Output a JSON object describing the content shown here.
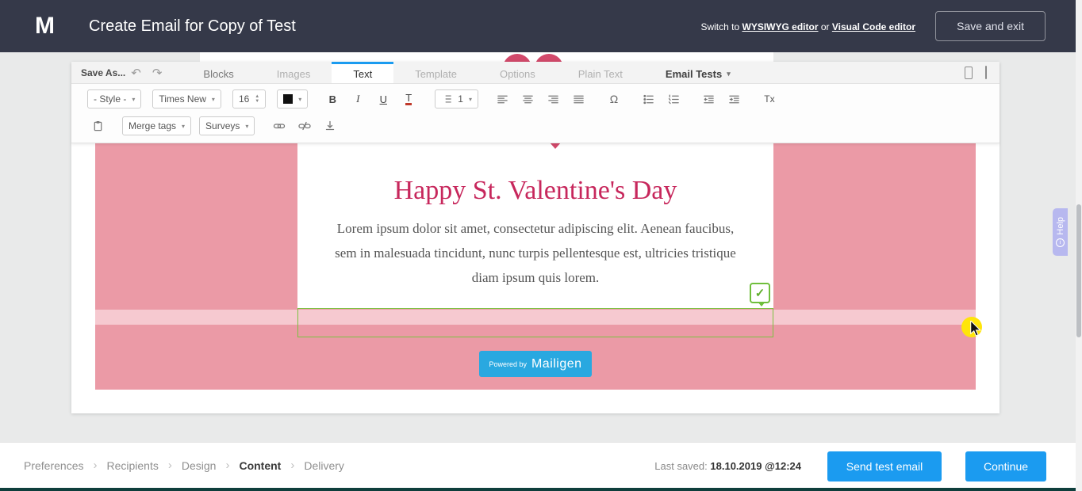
{
  "header": {
    "logo": "M",
    "title": "Create Email for Copy of Test",
    "switch_prefix": "Switch to",
    "switch_link1": "WYSIWYG editor",
    "switch_or": "or",
    "switch_link2": "Visual Code editor",
    "save_exit": "Save and exit"
  },
  "toolbar": {
    "save_as": "Save As...",
    "tabs": [
      {
        "label": "Blocks"
      },
      {
        "label": "Images"
      },
      {
        "label": "Text"
      },
      {
        "label": "Template"
      },
      {
        "label": "Options"
      },
      {
        "label": "Plain Text"
      },
      {
        "label": "Email Tests"
      }
    ],
    "style_dropdown": "- Style -",
    "font_dropdown": "Times New",
    "font_size": "16",
    "list_level": "1",
    "merge_tags": "Merge tags",
    "surveys": "Surveys",
    "clear_format": "Tx"
  },
  "icons": {
    "undo": "↶",
    "redo": "↷",
    "caret": "▾",
    "omega": "Ω",
    "bold": "B",
    "italic": "I",
    "underline": "U",
    "text_color": "T",
    "check": "✓",
    "breadcrumb_sep": "›",
    "stepper_up": "▲",
    "stepper_down": "▼",
    "help_info": "i"
  },
  "email": {
    "heading": "Happy St. Valentine's Day",
    "body": "Lorem ipsum dolor sit amet, consectetur adipiscing elit. Aenean faucibus, sem in malesuada tincidunt, nunc turpis pellentesque est, ultricies tristique diam ipsum quis lorem.",
    "powered_by": "Powered by",
    "brand": "Mailigen"
  },
  "help": {
    "label": "Help"
  },
  "footer": {
    "breadcrumbs": [
      {
        "label": "Preferences"
      },
      {
        "label": "Recipients"
      },
      {
        "label": "Design"
      },
      {
        "label": "Content"
      },
      {
        "label": "Delivery"
      }
    ],
    "last_saved_label": "Last saved:",
    "last_saved_value": "18.10.2019 @12:24",
    "send_test": "Send test email",
    "continue": "Continue"
  },
  "colors": {
    "accent_blue": "#1b9bf0",
    "header_bg": "#353949",
    "email_pink": "#eb9aa6",
    "stripe_pink": "#f6c9d0",
    "heading_pink": "#c7275c",
    "heart_pink": "#d2496b",
    "selection_green": "#7cc142",
    "powered_blue": "#29a8e0",
    "help_purple": "#b7b8ef",
    "cursor_yellow": "#ffe50a"
  }
}
